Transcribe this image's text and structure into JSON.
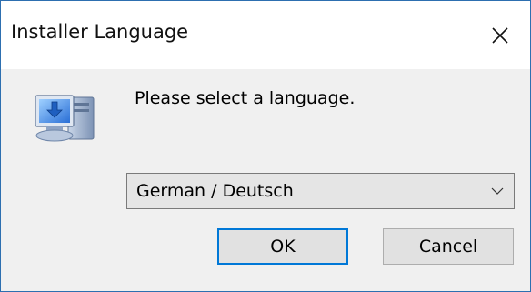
{
  "window": {
    "title": "Installer Language"
  },
  "dialog": {
    "prompt": "Please select a language.",
    "language_select": {
      "selected": "German / Deutsch"
    },
    "buttons": {
      "ok_label": "OK",
      "cancel_label": "Cancel"
    }
  },
  "icons": {
    "close": "close-icon",
    "installer": "installer-computer-icon",
    "dropdown": "chevron-down-icon"
  },
  "colors": {
    "accent": "#0078d7",
    "window_border": "#2d6fb0",
    "client_bg": "#f0f0f0"
  }
}
